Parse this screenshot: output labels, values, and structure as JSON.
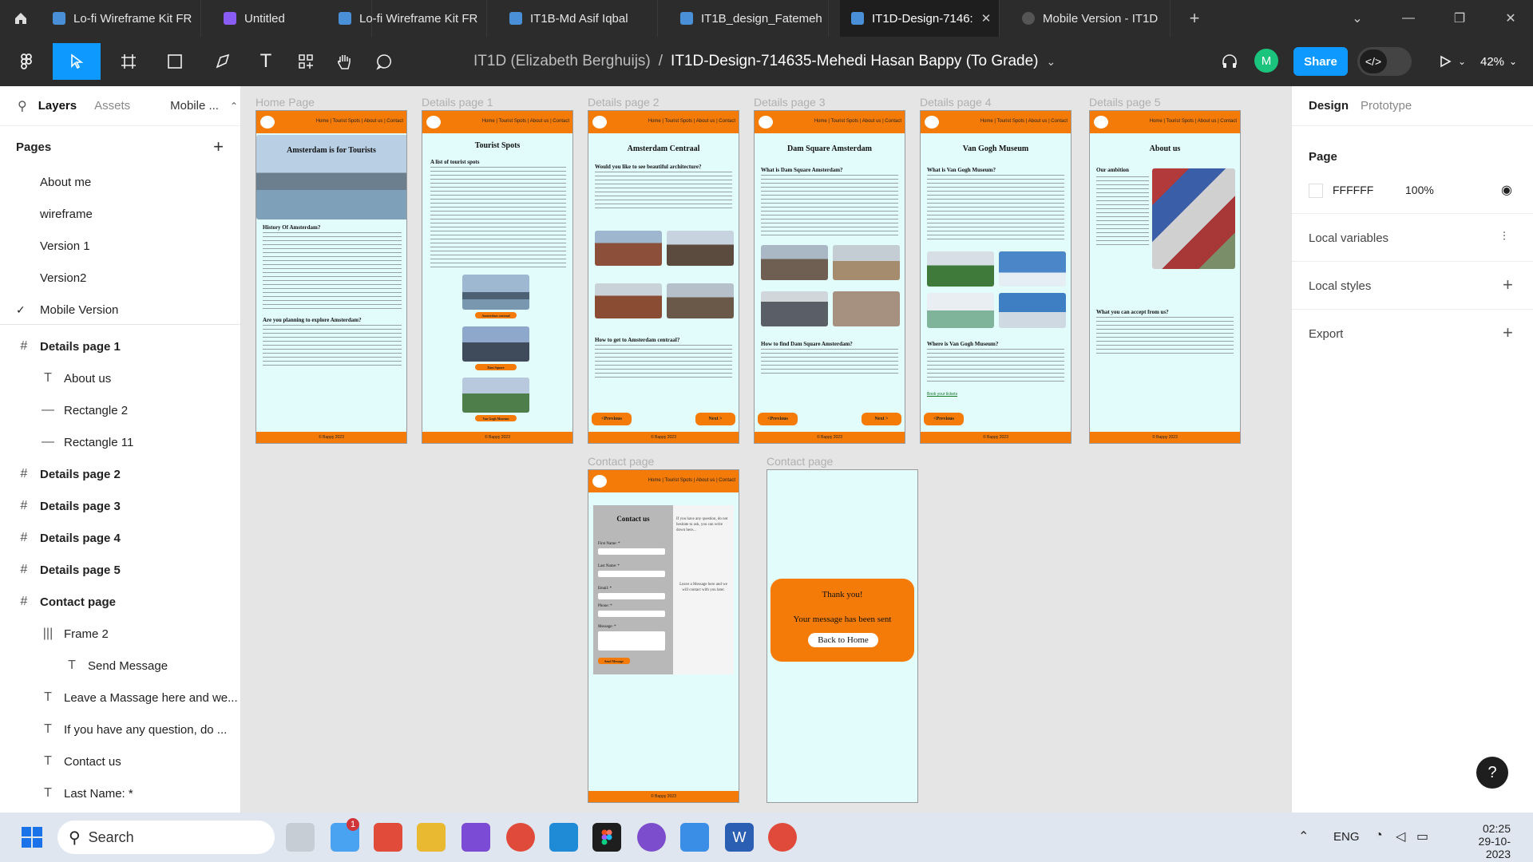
{
  "tabs": [
    {
      "label": "Lo-fi Wireframe Kit FR",
      "color": "#4a90d9"
    },
    {
      "label": "Untitled",
      "color": "#8a5cf6"
    },
    {
      "label": "Lo-fi Wireframe Kit FR",
      "color": "#4a90d9"
    },
    {
      "label": "IT1B-Md Asif Iqbal",
      "color": "#4a90d9"
    },
    {
      "label": "IT1B_design_Fatemeh",
      "color": "#4a90d9"
    },
    {
      "label": "IT1D-Design-7146:",
      "color": "#4a90d9"
    },
    {
      "label": "Mobile Version - IT1D",
      "color": "#555555"
    }
  ],
  "toolbar": {
    "crumb_team": "IT1D (Elizabeth Berghuijs)",
    "crumb_sep": "/",
    "crumb_file": "IT1D-Design-714635-Mehedi Hasan Bappy (To Grade)",
    "avatar": "M",
    "share": "Share",
    "zoom": "42%"
  },
  "left_panel": {
    "tabs": [
      "Layers",
      "Assets",
      "Mobile ..."
    ],
    "pages_title": "Pages",
    "pages": [
      "About me",
      "wireframe",
      "Version 1",
      "Version2",
      "Mobile Version"
    ],
    "layers": [
      {
        "label": "Details page 1",
        "icon": "#",
        "indent": 0,
        "bold": true
      },
      {
        "label": "About us",
        "icon": "T",
        "indent": 1
      },
      {
        "label": "Rectangle 2",
        "icon": "—",
        "indent": 1
      },
      {
        "label": "Rectangle 11",
        "icon": "—",
        "indent": 1
      },
      {
        "label": "Details page 2",
        "icon": "#",
        "indent": 0,
        "bold": true
      },
      {
        "label": "Details page 3",
        "icon": "#",
        "indent": 0,
        "bold": true
      },
      {
        "label": "Details page 4",
        "icon": "#",
        "indent": 0,
        "bold": true
      },
      {
        "label": "Details page 5",
        "icon": "#",
        "indent": 0,
        "bold": true
      },
      {
        "label": "Contact page",
        "icon": "#",
        "indent": 0,
        "bold": true
      },
      {
        "label": "Frame 2",
        "icon": "|||",
        "indent": 1
      },
      {
        "label": "Send Message",
        "icon": "T",
        "indent": 2
      },
      {
        "label": "Leave a Massage here and we...",
        "icon": "T",
        "indent": 1
      },
      {
        "label": "If you have any question, do ...",
        "icon": "T",
        "indent": 1
      },
      {
        "label": "Contact us",
        "icon": "T",
        "indent": 1
      },
      {
        "label": "Last Name: *",
        "icon": "T",
        "indent": 1
      },
      {
        "label": "Email: *",
        "icon": "T",
        "indent": 1
      }
    ]
  },
  "canvas": {
    "nav": "Home | Tourist Spots | About us | Contact",
    "footer": "© Bappy 2023",
    "frames": {
      "home": {
        "label": "Home Page",
        "title": "Amsterdam is for Tourists",
        "h1": "History Of Amsterdam?",
        "h2": "Are you planning to explore Amsterdam?"
      },
      "d1": {
        "label": "Details page 1",
        "title": "Tourist Spots",
        "h1": "A list of tourist spots",
        "cap1": "Amsterdam centraal",
        "cap2": "Dam Square",
        "cap3": "Van Gogh Museum"
      },
      "d2": {
        "label": "Details page 2",
        "title": "Amsterdam Centraal",
        "h1": "Would you like to see beautiful architecture?",
        "h2": "How to get to Amsterdam centraal?",
        "prev": "<Previous",
        "next": "Next >"
      },
      "d3": {
        "label": "Details page 3",
        "title": "Dam Square Amsterdam",
        "h1": "What is Dam Square Amsterdam?",
        "h2": "How to find Dam Square Amsterdam?",
        "prev": "<Previous",
        "next": "Next >"
      },
      "d4": {
        "label": "Details page 4",
        "title": "Van Gogh Museum",
        "h1": "What is Van Gogh Museum?",
        "h2": "Where is Van Gogh Museum?",
        "link": "Book your tickets",
        "prev": "<Previous"
      },
      "d5": {
        "label": "Details page 5",
        "title": "About us",
        "h1": "Our ambition",
        "h2": "What you can accept from us?"
      },
      "contact": {
        "label": "Contact page",
        "title": "Contact us",
        "f1": "First Name: *",
        "f2": "Last Name: *",
        "f3": "Email: *",
        "f4": "Phone: *",
        "f5": "Message: *",
        "send": "Send Message",
        "side": "If you have any question, do not hesitate to ask, you can write down here...",
        "side2": "Leave a Message here and we will contact with you later."
      },
      "thanks": {
        "label": "Contact page",
        "line1": "Thank you!",
        "line2": "Your message has been sent",
        "btn": "Back to Home"
      }
    }
  },
  "right_panel": {
    "tabs": [
      "Design",
      "Prototype"
    ],
    "page_title": "Page",
    "page_color": "FFFFFF",
    "page_opacity": "100%",
    "local_variables": "Local variables",
    "local_styles": "Local styles",
    "export": "Export",
    "help": "?"
  },
  "taskbar": {
    "search": "Search",
    "badge": "1",
    "lang": "ENG",
    "time": "02:25",
    "date": "29-10-2023"
  }
}
